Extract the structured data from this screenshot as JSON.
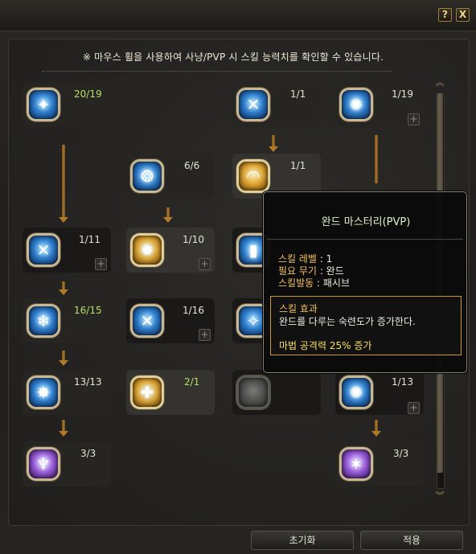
{
  "window": {
    "help_label": "?",
    "close_label": "X"
  },
  "notice": "※ 마우스 휠을 사용하여 사냥/PVP 시 스킬 능력치를 확인할 수 있습니다.",
  "skills": [
    {
      "level": "20/19",
      "icon": "lightning-burst-icon",
      "symbol": "✦"
    },
    {
      "level": "1/1",
      "icon": "shield-cross-icon",
      "symbol": "✕"
    },
    {
      "level": "1/19",
      "icon": "radiant-star-icon",
      "symbol": "✺"
    },
    {
      "level": "6/6",
      "icon": "swirl-wind-icon",
      "symbol": "❂"
    },
    {
      "level": "1/1",
      "icon": "golden-dome-icon",
      "symbol": "◠"
    },
    {
      "level": "1/11",
      "icon": "arcane-seal-icon",
      "symbol": "✕"
    },
    {
      "level": "1/10",
      "icon": "sunburst-icon",
      "symbol": "✹"
    },
    {
      "level": "16/15",
      "icon": "frost-circle-icon",
      "symbol": "❄"
    },
    {
      "level": "1/16",
      "icon": "crossed-blades-icon",
      "symbol": "✕"
    },
    {
      "level": "13/13",
      "icon": "ice-shatter-icon",
      "symbol": "✸"
    },
    {
      "level": "2/1",
      "icon": "golden-cross-icon",
      "symbol": "✚"
    },
    {
      "level": "1/13",
      "icon": "nova-blast-icon",
      "symbol": "✺"
    },
    {
      "level": "3/3",
      "icon": "spirit-figure-icon",
      "symbol": "♆"
    },
    {
      "level": "3/3",
      "icon": "purple-nova-icon",
      "symbol": "✶"
    },
    {
      "level": "",
      "icon": "locked-skill-icon",
      "symbol": ""
    },
    {
      "level": "",
      "icon": "blue-pillar-icon",
      "symbol": "▮"
    },
    {
      "level": "",
      "icon": "blue-rune-icon",
      "symbol": "✧"
    }
  ],
  "tooltip": {
    "title": "완드 마스터리(PVP)",
    "skill_level_key": "스킬 레벨",
    "skill_level_value": ": 1",
    "weapon_key": "필요 무기",
    "weapon_value": ": 완드",
    "activation_key": "스킬발동",
    "activation_value": ": 패시브",
    "effect_title": "스킬 효과",
    "effect_desc": "완드를 다루는 숙련도가 증가한다.",
    "effect_stat": "마법 공격력 25% 증가"
  },
  "plus_label": "+",
  "scroll": {
    "up": "︽",
    "down": "︾"
  },
  "buttons": {
    "reset": "초기화",
    "apply": "적용"
  },
  "colors": {
    "background": "#1b1a18",
    "level_green": "#b4e06a",
    "tooltip_key": "#f0c060",
    "effect_stat": "#f8e060",
    "effect_border": "#c89a30"
  }
}
